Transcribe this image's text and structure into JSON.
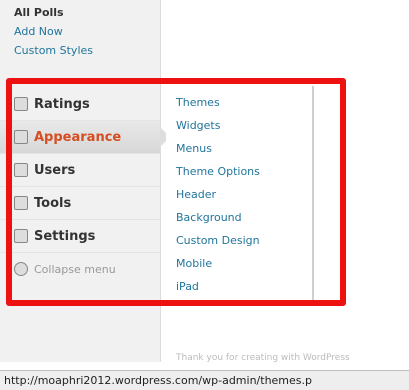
{
  "subnav": [
    "All Polls",
    "Add Now",
    "Custom Styles"
  ],
  "menu": [
    {
      "label": "Ratings",
      "icon": "ratings-icon"
    },
    {
      "label": "Appearance",
      "icon": "appearance-icon",
      "active": true
    },
    {
      "label": "Users",
      "icon": "users-icon"
    },
    {
      "label": "Tools",
      "icon": "tools-icon"
    },
    {
      "label": "Settings",
      "icon": "settings-icon"
    }
  ],
  "collapse_label": "Collapse menu",
  "submenu": [
    "Themes",
    "Widgets",
    "Menus",
    "Theme Options",
    "Header",
    "Background",
    "Custom Design",
    "Mobile",
    "iPad"
  ],
  "footer_text": "Thank you for creating with WordPress",
  "status_url": "http://moaphri2012.wordpress.com/wp-admin/themes.p",
  "colors": {
    "highlight": "#ee1111",
    "link": "#21759b",
    "active": "#d54e21"
  }
}
